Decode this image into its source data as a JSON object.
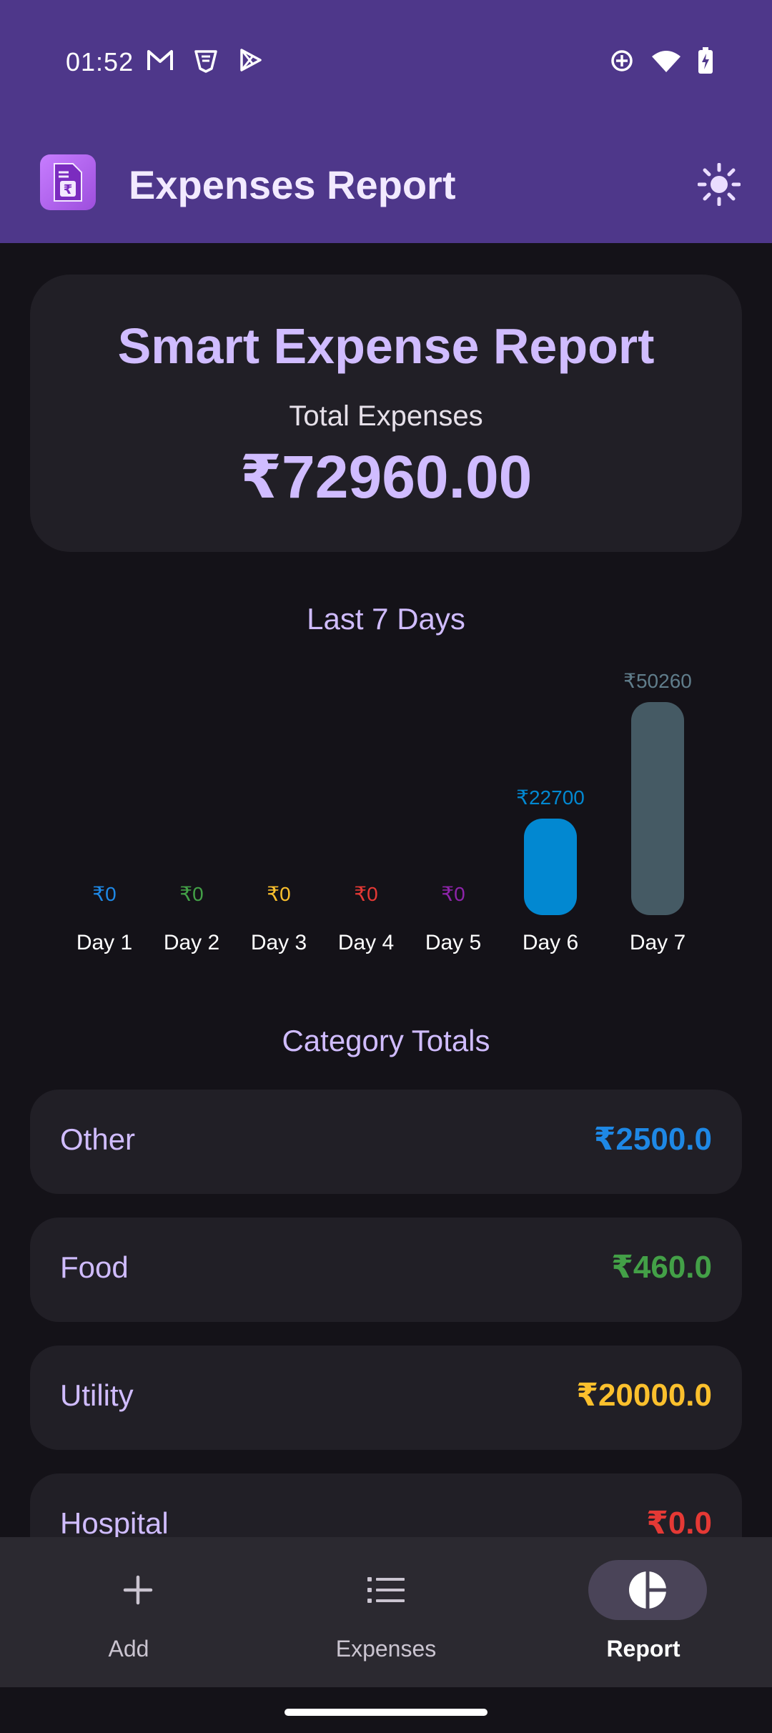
{
  "status_bar": {
    "time": "01:52"
  },
  "app_bar": {
    "title": "Expenses Report",
    "logo_glyph": "₹"
  },
  "summary": {
    "title": "Smart Expense Report",
    "total_label": "Total Expenses",
    "total_value": "₹72960.00"
  },
  "chart_section_title": "Last 7 Days",
  "chart_data": {
    "type": "bar",
    "categories": [
      "Day 1",
      "Day 2",
      "Day 3",
      "Day 4",
      "Day 5",
      "Day 6",
      "Day 7"
    ],
    "values": [
      0,
      0,
      0,
      0,
      0,
      22700,
      50260
    ],
    "value_labels": [
      "₹0",
      "₹0",
      "₹0",
      "₹0",
      "₹0",
      "₹22700",
      "₹50260"
    ],
    "colors": [
      "#1e88e5",
      "#43a047",
      "#fbc02d",
      "#e53935",
      "#8e24aa",
      "#0288d1",
      "#455a64"
    ],
    "label_colors": [
      "#1e88e5",
      "#43a047",
      "#fbc02d",
      "#e53935",
      "#8e24aa",
      "#0288d1",
      "#607d8b"
    ],
    "title": "Last 7 Days"
  },
  "category_section_title": "Category Totals",
  "categories": [
    {
      "name": "Other",
      "amount": "₹2500.0",
      "color": "#1e88e5"
    },
    {
      "name": "Food",
      "amount": "₹460.0",
      "color": "#43a047"
    },
    {
      "name": "Utility",
      "amount": "₹20000.0",
      "color": "#fbc02d"
    },
    {
      "name": "Hospital",
      "amount": "₹0.0",
      "color": "#e53935"
    }
  ],
  "nav": {
    "add": "Add",
    "expenses": "Expenses",
    "report": "Report"
  }
}
